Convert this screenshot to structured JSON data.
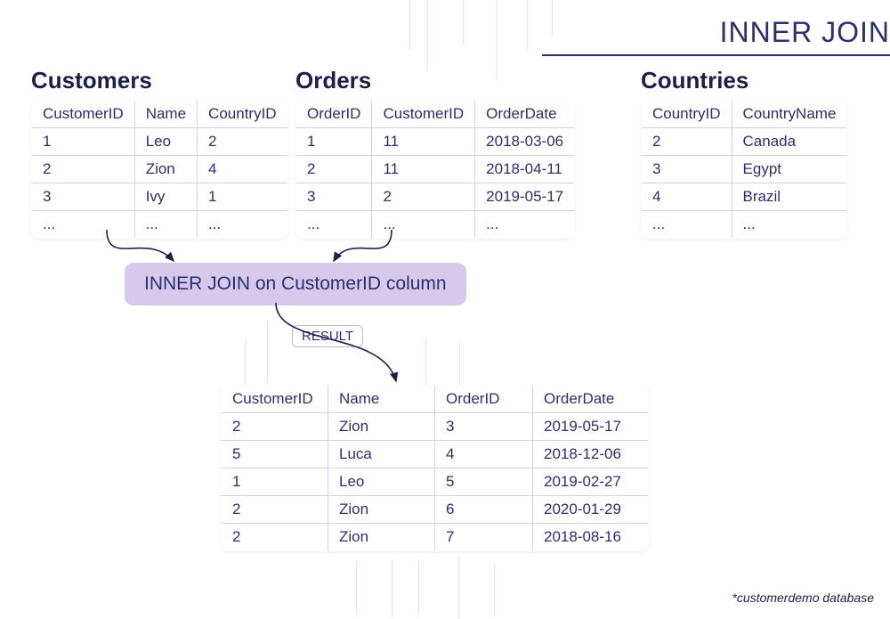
{
  "title": "INNER JOIN",
  "tables": {
    "customers": {
      "title": "Customers",
      "columns": [
        "CustomerID",
        "Name",
        "CountryID"
      ],
      "rows": [
        [
          "1",
          "Leo",
          "2"
        ],
        [
          "2",
          "Zion",
          "4"
        ],
        [
          "3",
          "Ivy",
          "1"
        ],
        [
          "...",
          "...",
          "..."
        ]
      ]
    },
    "orders": {
      "title": "Orders",
      "columns": [
        "OrderID",
        "CustomerID",
        "OrderDate"
      ],
      "rows": [
        [
          "1",
          "11",
          "2018-03-06"
        ],
        [
          "2",
          "11",
          "2018-04-11"
        ],
        [
          "3",
          "2",
          "2019-05-17"
        ],
        [
          "...",
          "...",
          "..."
        ]
      ]
    },
    "countries": {
      "title": "Countries",
      "columns": [
        "CountryID",
        "CountryName"
      ],
      "rows": [
        [
          "2",
          "Canada"
        ],
        [
          "3",
          "Egypt"
        ],
        [
          "4",
          "Brazil"
        ],
        [
          "...",
          "..."
        ]
      ]
    },
    "result": {
      "columns": [
        "CustomerID",
        "Name",
        "OrderID",
        "OrderDate"
      ],
      "rows": [
        [
          "2",
          "Zion",
          "3",
          "2019-05-17"
        ],
        [
          "5",
          "Luca",
          "4",
          "2018-12-06"
        ],
        [
          "1",
          "Leo",
          "5",
          "2019-02-27"
        ],
        [
          "2",
          "Zion",
          "6",
          "2020-01-29"
        ],
        [
          "2",
          "Zion",
          "7",
          "2018-08-16"
        ]
      ]
    }
  },
  "join_label": "INNER JOIN on CustomerID column",
  "result_label": "RESULT",
  "footnote": "*customerdemo database",
  "chart_data": {
    "type": "table",
    "title": "INNER JOIN diagram: Customers ⋈ Orders on CustomerID, plus Countries and result",
    "tables": [
      {
        "name": "Customers",
        "columns": [
          "CustomerID",
          "Name",
          "CountryID"
        ],
        "rows": [
          [
            "1",
            "Leo",
            "2"
          ],
          [
            "2",
            "Zion",
            "4"
          ],
          [
            "3",
            "Ivy",
            "1"
          ]
        ]
      },
      {
        "name": "Orders",
        "columns": [
          "OrderID",
          "CustomerID",
          "OrderDate"
        ],
        "rows": [
          [
            "1",
            "11",
            "2018-03-06"
          ],
          [
            "2",
            "11",
            "2018-04-11"
          ],
          [
            "3",
            "2",
            "2019-05-17"
          ]
        ]
      },
      {
        "name": "Countries",
        "columns": [
          "CountryID",
          "CountryName"
        ],
        "rows": [
          [
            "2",
            "Canada"
          ],
          [
            "3",
            "Egypt"
          ],
          [
            "4",
            "Brazil"
          ]
        ]
      },
      {
        "name": "Result (INNER JOIN on CustomerID)",
        "columns": [
          "CustomerID",
          "Name",
          "OrderID",
          "OrderDate"
        ],
        "rows": [
          [
            "2",
            "Zion",
            "3",
            "2019-05-17"
          ],
          [
            "5",
            "Luca",
            "4",
            "2018-12-06"
          ],
          [
            "1",
            "Leo",
            "5",
            "2019-02-27"
          ],
          [
            "2",
            "Zion",
            "6",
            "2020-01-29"
          ],
          [
            "2",
            "Zion",
            "7",
            "2018-08-16"
          ]
        ]
      }
    ]
  }
}
